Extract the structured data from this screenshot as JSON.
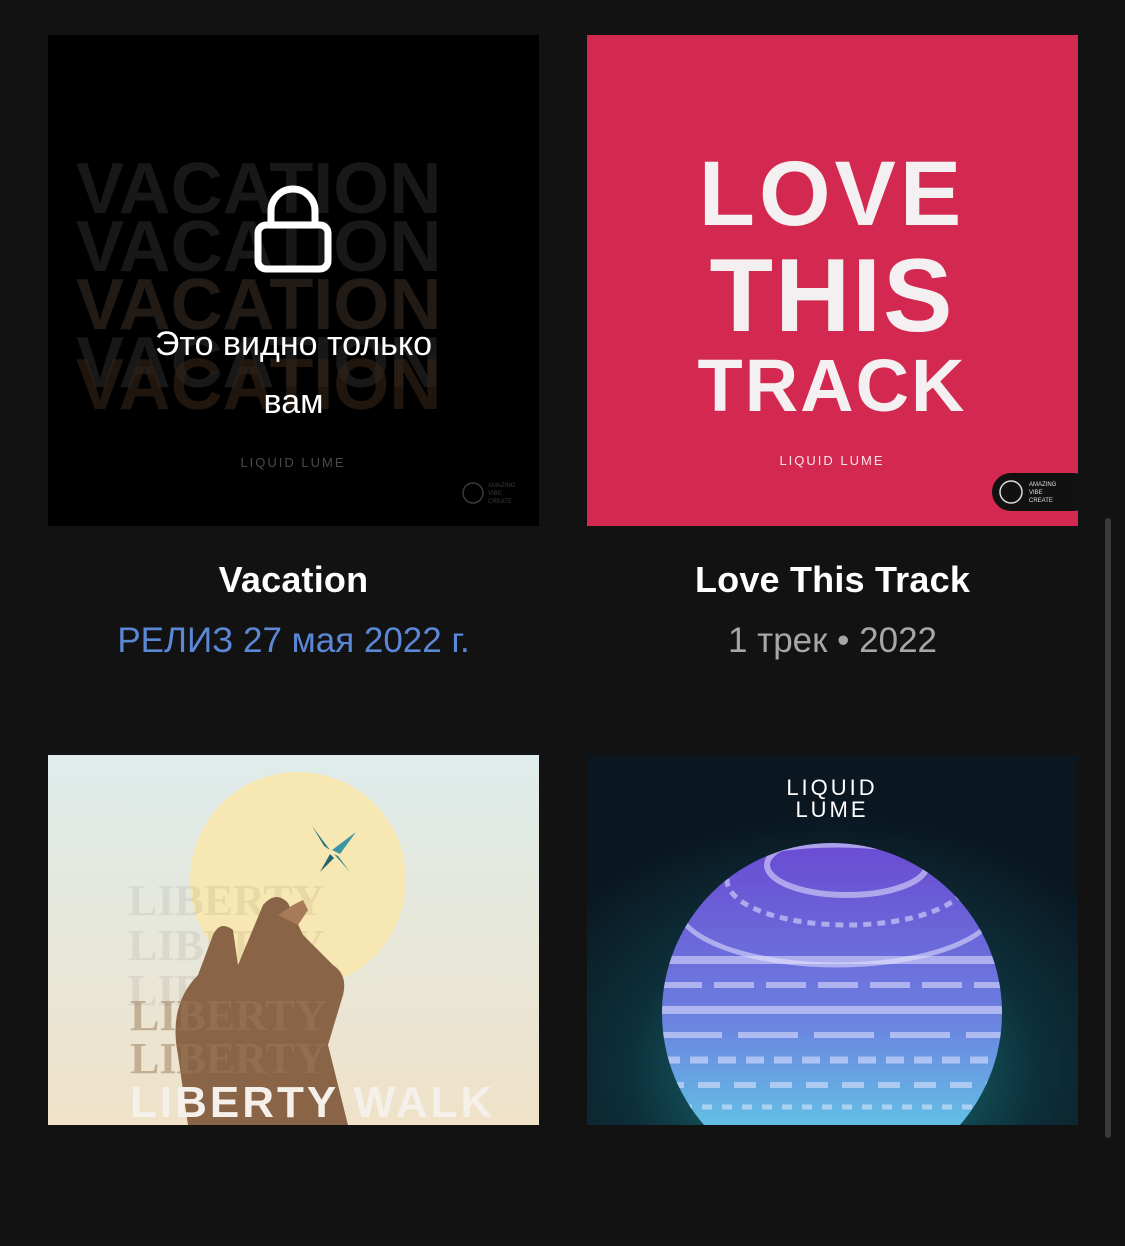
{
  "items": [
    {
      "title": "Vacation",
      "meta": "РЕЛИЗ 27 мая 2022 г.",
      "cover_text": "VACATION",
      "cover_brand": "LIQUID LUME",
      "badge_text": [
        "AMAZING",
        "VIBE",
        "CREATE"
      ],
      "lock_text_line1": "Это видно только",
      "lock_text_line2": "вам",
      "lock_icon": "lock-icon"
    },
    {
      "title": "Love This Track",
      "meta": "1 трек • 2022",
      "cover_text_line1": "LOVE",
      "cover_text_line2": "THIS",
      "cover_text_line3": "TRACK",
      "cover_brand": "LIQUID LUME",
      "badge_text": [
        "AMAZING",
        "VIBE",
        "CREATE"
      ]
    },
    {
      "cover_text": "LIBERTY WALK",
      "cover_text_repeat": "LIBERTY"
    },
    {
      "cover_brand_line1": "LIQUID",
      "cover_brand_line2": "LUME"
    }
  ],
  "colors": {
    "background": "#121212",
    "release_accent": "#5b88d6",
    "love_cover": "#d3284f",
    "muted": "#a7a7a7"
  }
}
